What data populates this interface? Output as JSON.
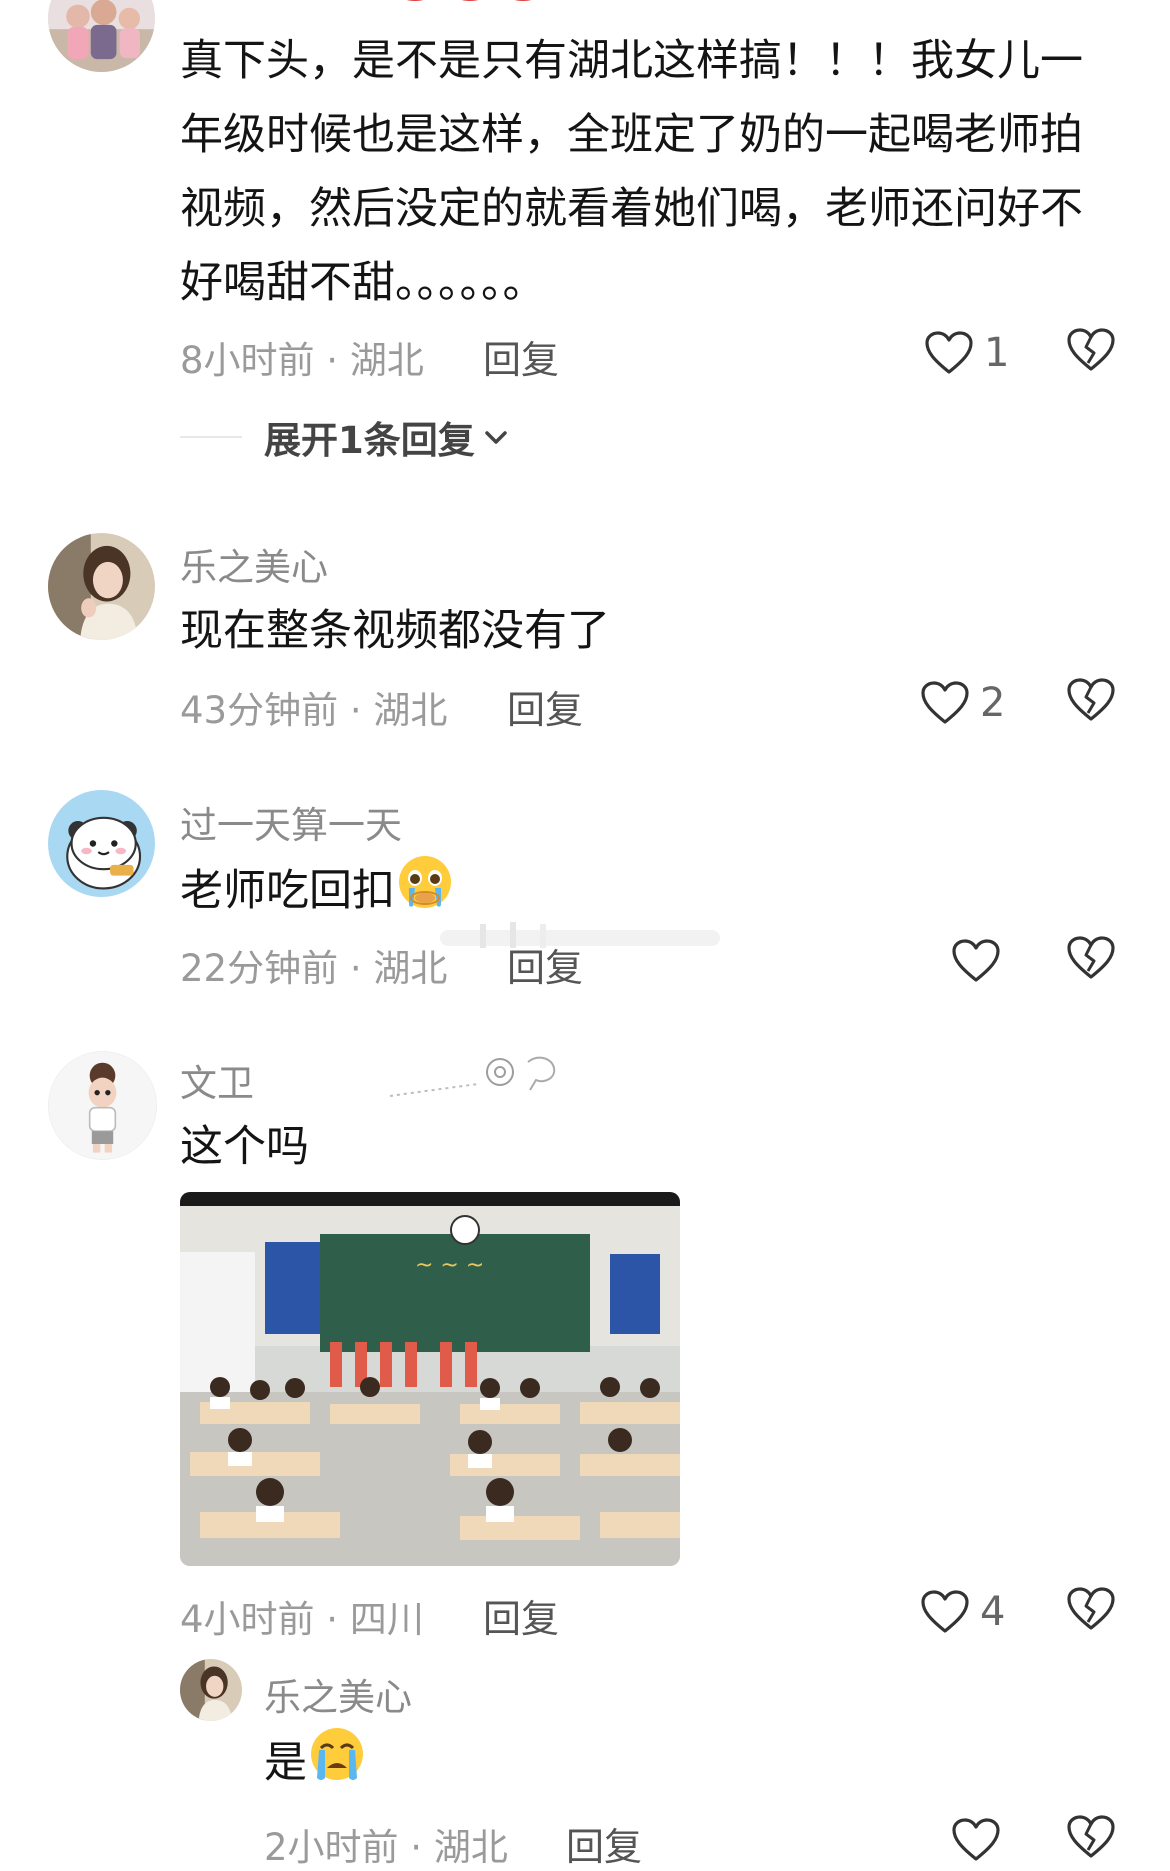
{
  "comments": [
    {
      "text": "真下头，是不是只有湖北这样搞！！！我女儿一年级时候也是这样，全班定了奶的一起喝老师拍视频，然后没定的就看着她们喝，老师还问好不好喝甜不甜。。。。。。",
      "meta": "8小时前 · 湖北",
      "reply_label": "回复",
      "likes": "1",
      "expand_label": "展开1条回复"
    },
    {
      "name": "乐之美心",
      "text": "现在整条视频都没有了",
      "meta": "43分钟前 · 湖北",
      "reply_label": "回复",
      "likes": "2"
    },
    {
      "name": "过一天算一天",
      "text": "老师吃回扣",
      "meta": "22分钟前 · 湖北",
      "reply_label": "回复",
      "likes": ""
    },
    {
      "name": "文卫",
      "text": "这个吗",
      "meta": "4小时前 · 四川",
      "reply_label": "回复",
      "likes": "4"
    }
  ],
  "reply": {
    "name": "乐之美心",
    "text": "是",
    "meta": "2小时前 · 湖北",
    "reply_label": "回复",
    "likes": ""
  },
  "icons": {
    "like": "heart-outline-icon",
    "dislike": "broken-heart-icon",
    "expand": "chevron-down-icon",
    "emoji_pleading": "pleading-face-emoji",
    "emoji_crying": "crying-face-emoji"
  },
  "colors": {
    "text": "#141414",
    "meta": "#9a9a9a",
    "name": "#8a8a8a",
    "icon": "#333333"
  }
}
